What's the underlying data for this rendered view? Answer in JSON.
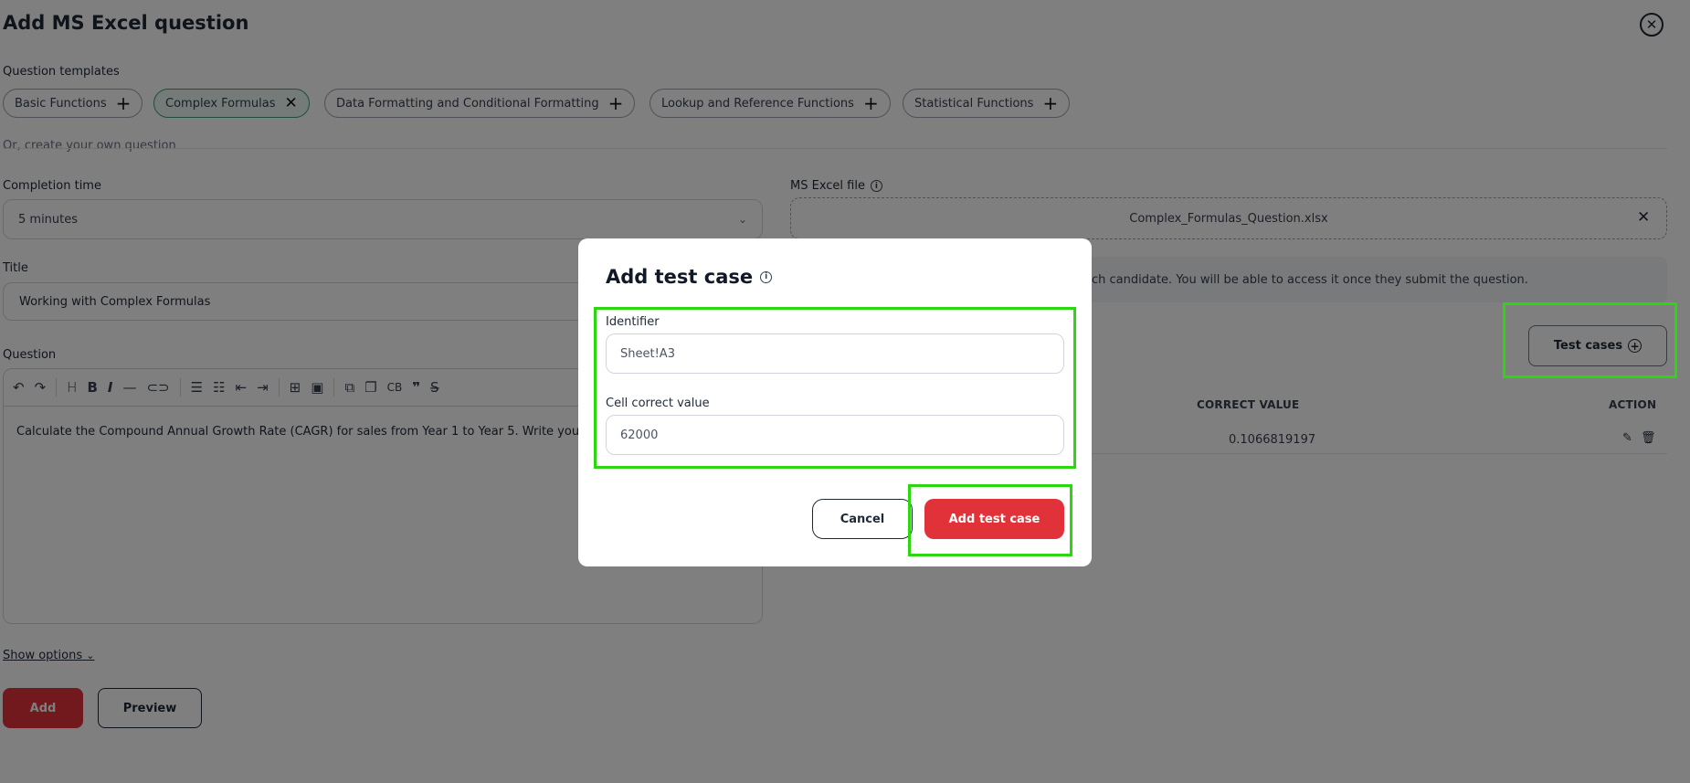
{
  "header": {
    "title": "Add MS Excel question"
  },
  "templates": {
    "label": "Question templates",
    "items": [
      {
        "label": "Basic Functions",
        "active": false
      },
      {
        "label": "Complex Formulas",
        "active": true
      },
      {
        "label": "Data Formatting and Conditional Formatting",
        "active": false
      },
      {
        "label": "Lookup and Reference Functions",
        "active": false
      },
      {
        "label": "Statistical Functions",
        "active": false
      }
    ]
  },
  "custom_question_text": "Or, create your own question",
  "completion_time": {
    "label": "Completion time",
    "value": "5 minutes"
  },
  "title_field": {
    "label": "Title",
    "value": "Working with Complex Formulas"
  },
  "question": {
    "label": "Question",
    "toolbar": {
      "code_block": "CB"
    },
    "body": "Calculate the Compound Annual Growth Rate (CAGR) for sales from Year 1 to Year 5. Write you"
  },
  "show_options": "Show options",
  "actions": {
    "add": "Add",
    "preview": "Preview"
  },
  "excel_file": {
    "label": "MS Excel file",
    "filename": "Complex_Formulas_Question.xlsx",
    "notice": "ch candidate. You will be able to access it once they submit the question."
  },
  "test_cases": {
    "button": "Test cases",
    "columns": {
      "correct_value": "CORRECT VALUE",
      "action": "ACTION"
    },
    "rows": [
      {
        "correct_value": "0.1066819197"
      }
    ]
  },
  "modal": {
    "title": "Add test case",
    "identifier": {
      "label": "Identifier",
      "value": "Sheet!A3"
    },
    "cell_value": {
      "label": "Cell correct value",
      "value": "62000"
    },
    "cancel": "Cancel",
    "submit": "Add test case"
  },
  "colors": {
    "primary": "#e23239",
    "highlight": "#2bd80f",
    "active_chip": "#3f9c72"
  }
}
